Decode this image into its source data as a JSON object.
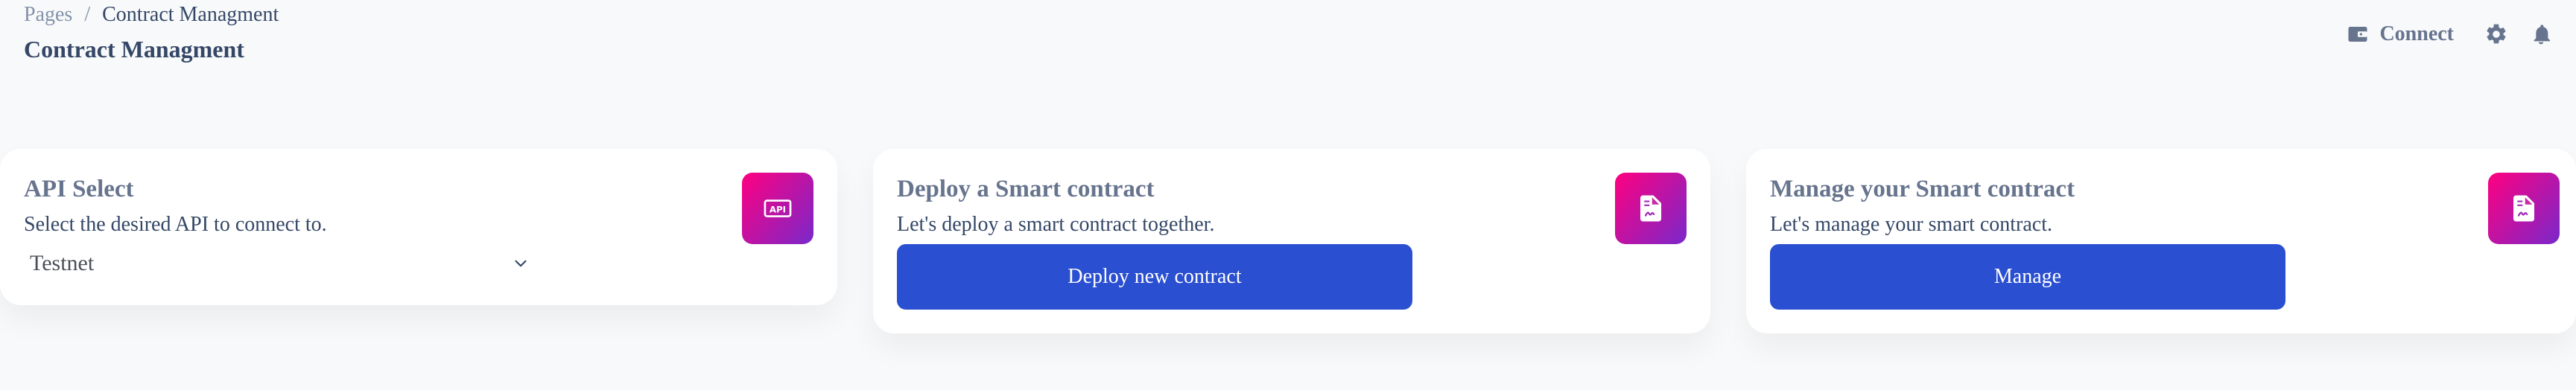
{
  "breadcrumb": {
    "parent": "Pages",
    "separator": "/",
    "current": "Contract Managment"
  },
  "page_title": "Contract Managment",
  "topnav": {
    "connect_label": "Connect",
    "icons": [
      "wallet-icon",
      "gear-icon",
      "bell-icon"
    ]
  },
  "cards": {
    "api_select": {
      "title": "API Select",
      "description": "Select the desired API to connect to.",
      "selected_value": "Testnet",
      "icon": "api-icon"
    },
    "deploy": {
      "title": "Deploy a Smart contract",
      "description": "Let's deploy a smart contract together.",
      "button_label": "Deploy new contract",
      "icon": "file-contract-icon"
    },
    "manage": {
      "title": "Manage your Smart contract",
      "description": "Let's manage your smart contract.",
      "button_label": "Manage",
      "icon": "file-contract-icon"
    }
  },
  "colors": {
    "background": "#f8f9fa",
    "primary_button": "#2a4fd1",
    "icon_gradient_start": "#ff0080",
    "icon_gradient_end": "#7928ca",
    "title_text": "#344767",
    "muted_text": "#67748e"
  }
}
